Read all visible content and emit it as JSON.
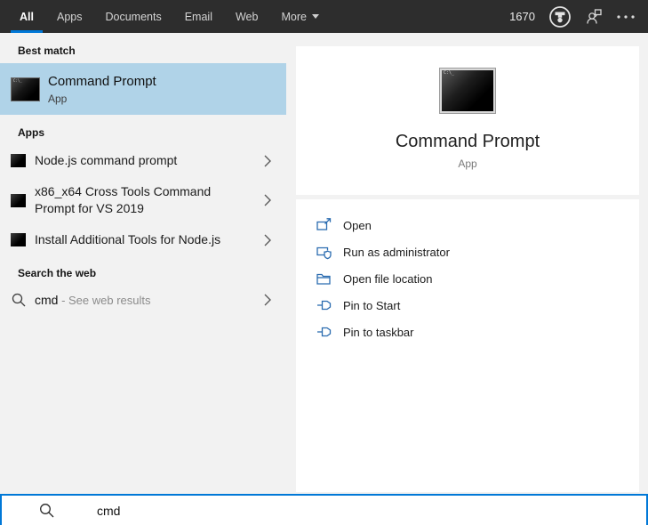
{
  "header": {
    "tabs": [
      {
        "label": "All",
        "active": true
      },
      {
        "label": "Apps",
        "active": false
      },
      {
        "label": "Documents",
        "active": false
      },
      {
        "label": "Email",
        "active": false
      },
      {
        "label": "Web",
        "active": false
      },
      {
        "label": "More",
        "active": false,
        "has_caret": true
      }
    ],
    "rewards_points": "1670"
  },
  "left": {
    "best_match": {
      "header": "Best match",
      "item": {
        "title": "Command Prompt",
        "subtitle": "App"
      }
    },
    "apps": {
      "header": "Apps",
      "items": [
        {
          "title": "Node.js command prompt"
        },
        {
          "title": "x86_x64 Cross Tools Command Prompt for VS 2019"
        },
        {
          "title": "Install Additional Tools for Node.js"
        }
      ]
    },
    "web": {
      "header": "Search the web",
      "item": {
        "query": "cmd",
        "suffix": " - See web results"
      }
    }
  },
  "preview": {
    "title": "Command Prompt",
    "subtitle": "App",
    "actions": [
      {
        "label": "Open",
        "icon": "open-icon"
      },
      {
        "label": "Run as administrator",
        "icon": "admin-shield-icon"
      },
      {
        "label": "Open file location",
        "icon": "folder-icon"
      },
      {
        "label": "Pin to Start",
        "icon": "pin-icon"
      },
      {
        "label": "Pin to taskbar",
        "icon": "pin-icon"
      }
    ]
  },
  "search_bar": {
    "value": "cmd"
  },
  "icons": {
    "rewards": "medal-in-circle",
    "feedback": "person-with-speech-bubble",
    "more_options": "ellipsis",
    "terminal": "black-command-prompt-window",
    "search": "magnifier"
  },
  "colors": {
    "accent": "#0078d7",
    "topbar_bg": "#2d2d2d",
    "highlight_bg": "#b0d3e8",
    "panel_bg": "#f2f2f2",
    "card_bg": "#ffffff",
    "action_icon_blue": "#2b6cb0"
  }
}
